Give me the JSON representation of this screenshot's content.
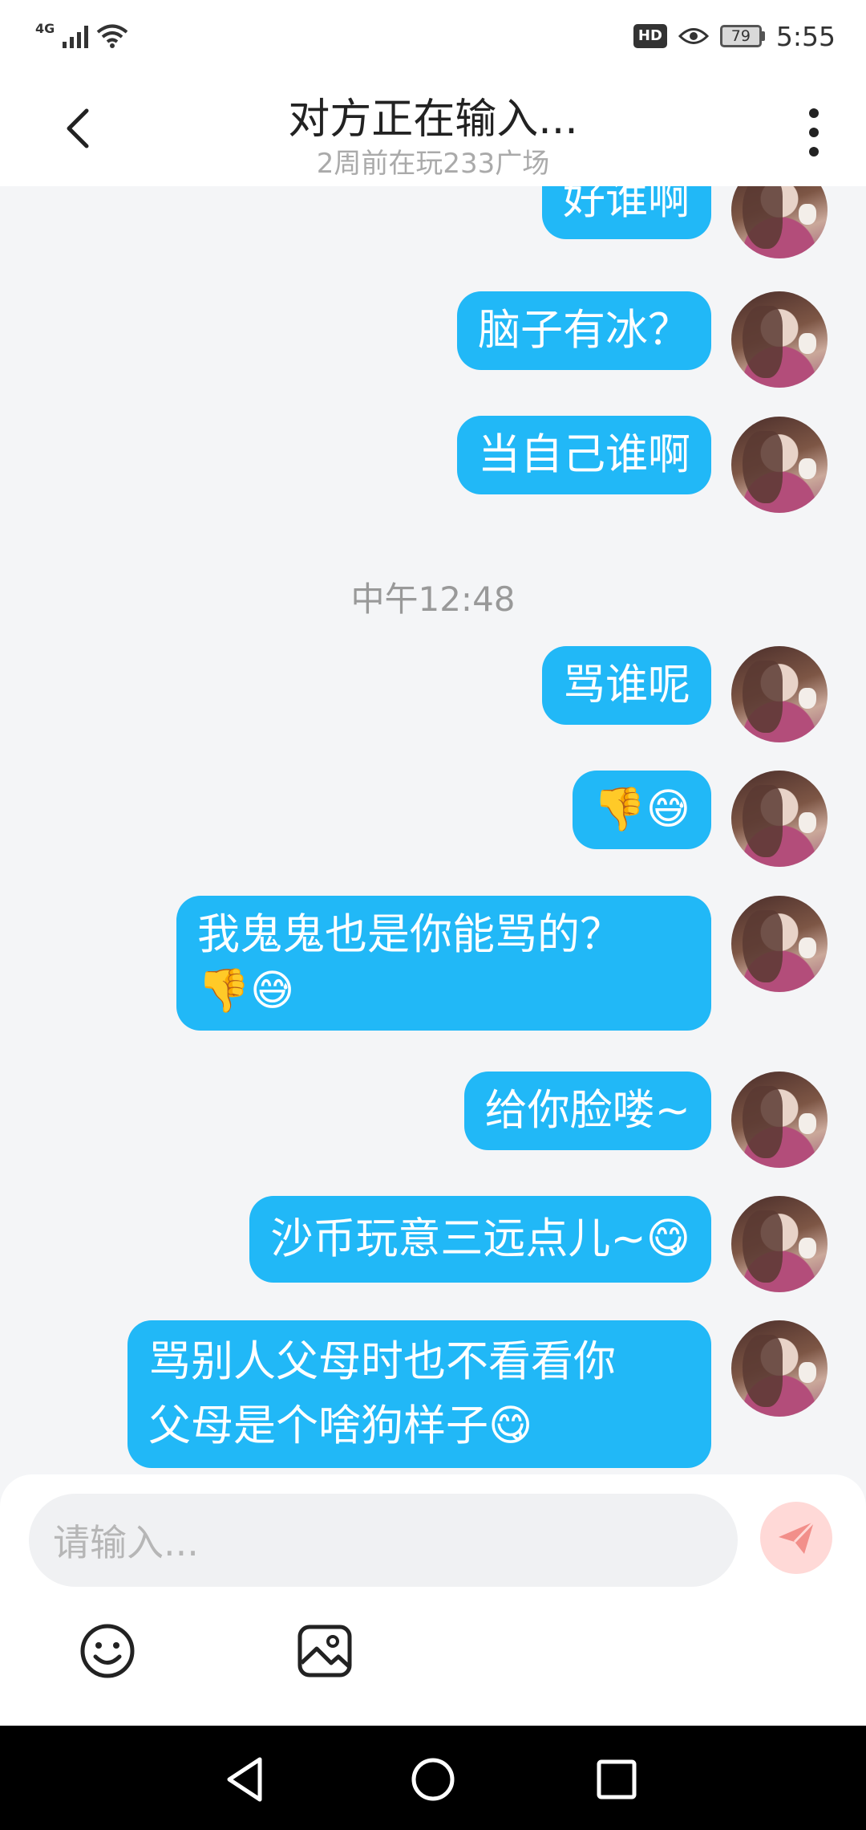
{
  "status_bar": {
    "network": "4G",
    "battery": "79",
    "time": "5:55"
  },
  "header": {
    "title": "对方正在输入...",
    "subtitle": "2周前在玩233广场"
  },
  "messages": [
    {
      "text": "好谁啊"
    },
    {
      "text": "脑子有冰？"
    },
    {
      "text": "当自己谁啊"
    },
    {
      "text": "骂谁呢"
    },
    {
      "text": "👎😅"
    },
    {
      "text": "我鬼鬼也是你能骂的？\n👎😅"
    },
    {
      "text": "给你脸喽~"
    },
    {
      "text": "沙币玩意三远点儿~😋"
    },
    {
      "text": "骂别人父母时也不看看你\n父母是个啥狗样子😋"
    }
  ],
  "timestamp": "中午12:48",
  "input": {
    "placeholder": "请输入..."
  },
  "icons": {
    "back": "back-arrow-icon",
    "more": "more-vertical-icon",
    "send": "send-icon",
    "emoji": "emoji-icon",
    "image": "image-icon"
  },
  "colors": {
    "bubble": "#21b8f7",
    "send_bg": "#ffd9d7",
    "send_icon": "#f28f8a"
  }
}
